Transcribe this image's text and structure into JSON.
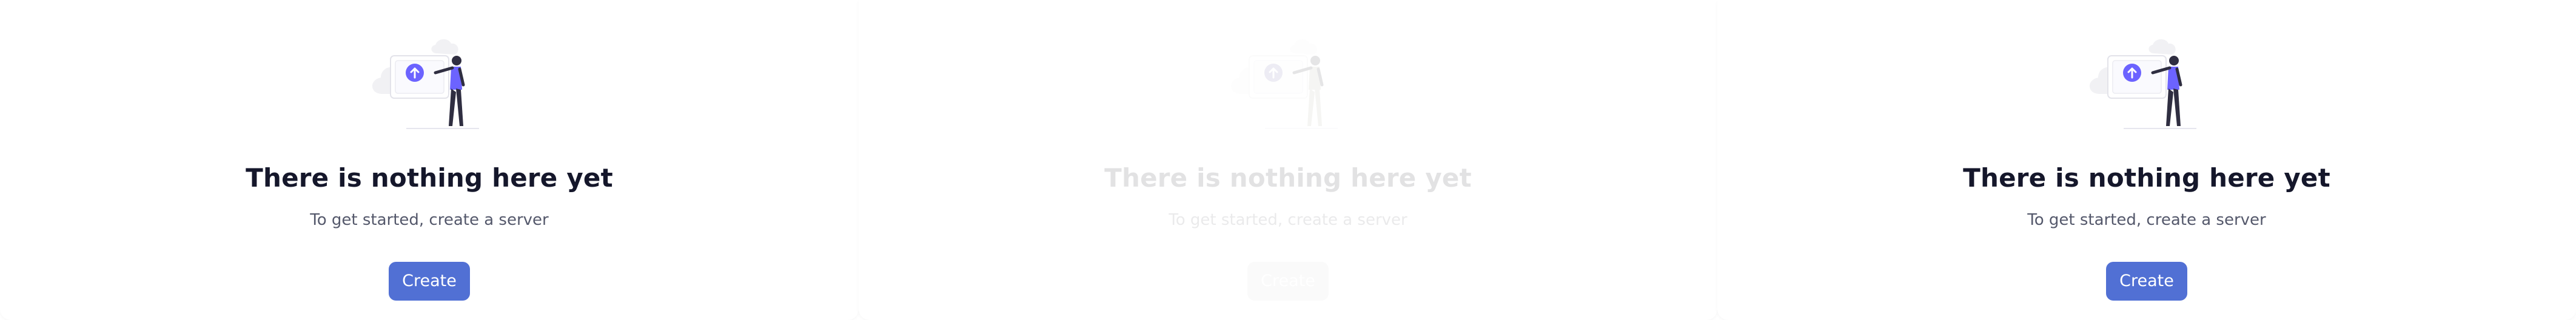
{
  "empty_states": [
    {
      "heading": "There is nothing here yet",
      "subtext": "To get started, create a server",
      "button_label": "Create",
      "state": "normal"
    },
    {
      "heading": "There is nothing here yet",
      "subtext": "To get started, create a server",
      "button_label": "Create",
      "state": "faded"
    },
    {
      "heading": "There is nothing here yet",
      "subtext": "To get started, create a server",
      "button_label": "Create",
      "state": "normal"
    }
  ],
  "colors": {
    "accent": "#5170d4",
    "illustration_purple": "#6c63ff",
    "heading": "#15172b",
    "subtext": "#54586b"
  },
  "icons": {
    "illustration": "person-presenting-upload-illustration",
    "upload": "upload-arrow-icon"
  }
}
